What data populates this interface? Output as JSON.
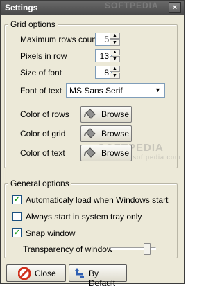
{
  "window": {
    "title": "Settings",
    "close_glyph": "×"
  },
  "grid_options": {
    "title": "Grid options",
    "max_rows": {
      "label": "Maximum rows count",
      "value": "5"
    },
    "pixels_in_row": {
      "label": "Pixels in row",
      "value": "13"
    },
    "font_size": {
      "label": "Size of font",
      "value": "8"
    },
    "font_of_text": {
      "label": "Font of text",
      "value": "MS Sans Serif"
    },
    "color_rows": {
      "label": "Color of rows",
      "button": "Browse"
    },
    "color_grid": {
      "label": "Color of grid",
      "button": "Browse"
    },
    "color_text": {
      "label": "Color of text",
      "button": "Browse"
    }
  },
  "general_options": {
    "title": "General options",
    "autoload": {
      "label": "Automaticaly load when Windows start",
      "checked": true
    },
    "start_tray": {
      "label": "Always start in system tray only",
      "checked": false
    },
    "snap_window": {
      "label": "Snap window",
      "checked": true
    },
    "transparency": {
      "label": "Transparency of window",
      "value_fraction": 0.85
    }
  },
  "buttons": {
    "close": "Close",
    "default": "By Default"
  },
  "watermark": {
    "text": "SOFTPEDIA",
    "url": "www.softpedia.com"
  },
  "colors": {
    "window_bg": "#ece9d8",
    "titlebar": "#555555",
    "check_green": "#21a121",
    "close_icon_red": "#d0321e",
    "default_icon_blue": "#2f5fb3"
  },
  "icons": {
    "browse": "paint-bucket-icon",
    "close": "no-entry-icon",
    "default": "undo-arrow-icon"
  }
}
